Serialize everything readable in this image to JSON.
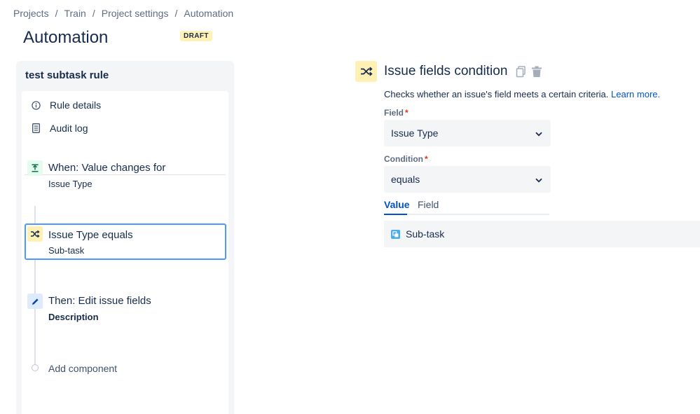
{
  "breadcrumb": [
    "Projects",
    "Train",
    "Project settings",
    "Automation"
  ],
  "page": {
    "title": "Automation",
    "badge": "DRAFT"
  },
  "rule": {
    "name": "test subtask rule",
    "menu": [
      {
        "label": "Rule details",
        "icon": "info-icon"
      },
      {
        "label": "Audit log",
        "icon": "document-icon"
      }
    ],
    "steps": [
      {
        "title": "When: Value changes for",
        "sub": "Issue Type",
        "icon": "trigger-icon",
        "color": "#e3fcef"
      },
      {
        "title": "Issue Type equals",
        "sub": "Sub-task",
        "icon": "shuffle-icon",
        "color": "#fff0b3"
      },
      {
        "title": "Then: Edit issue fields",
        "sub": "Description",
        "icon": "pencil-icon",
        "color": "#deebff"
      }
    ],
    "add_component": "Add component"
  },
  "detail": {
    "title": "Issue fields condition",
    "description": "Checks whether an issue's field meets a certain criteria.",
    "learn_more": "Learn more.",
    "field_label": "Field",
    "field_value": "Issue Type",
    "condition_label": "Condition",
    "condition_value": "equals",
    "required_mark": "*",
    "tabs": [
      "Value",
      "Field"
    ],
    "value": "Sub-task"
  },
  "colors": {
    "accent": "#0052cc",
    "condition_bg": "#fff0b3",
    "selected_border": "#4c9aff"
  }
}
